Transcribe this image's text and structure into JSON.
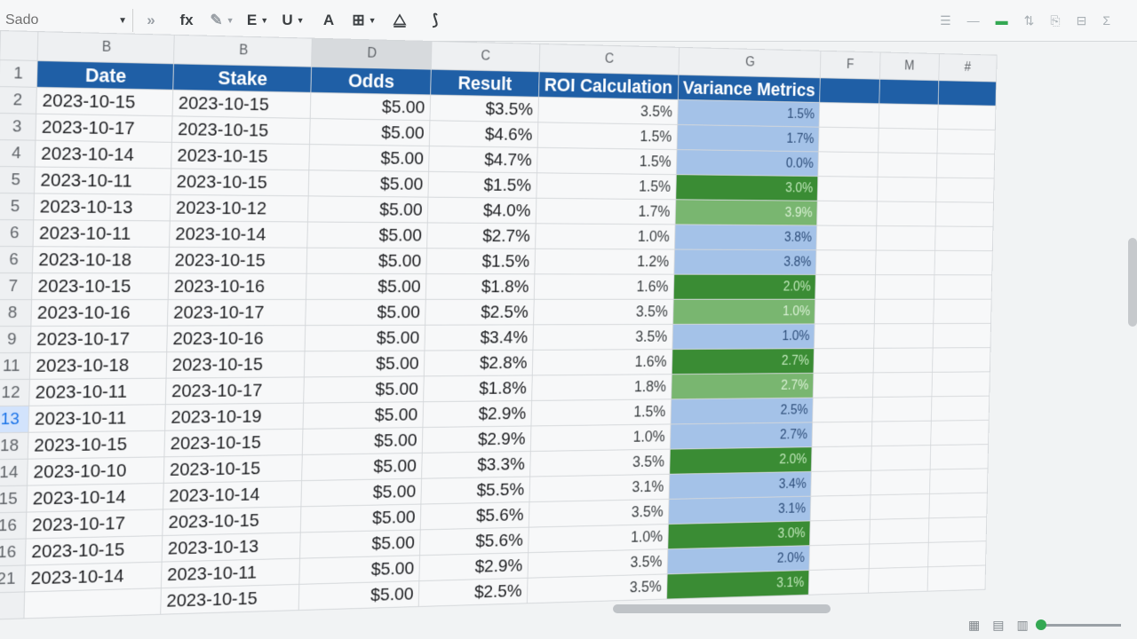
{
  "toolbar": {
    "name_box": "Sado",
    "buttons": [
      {
        "name": "collapse-icon",
        "glyph": "»",
        "faint": true
      },
      {
        "name": "function-icon",
        "glyph": "fx",
        "faint": false
      },
      {
        "name": "paint-format-icon",
        "glyph": "✎",
        "faint": true,
        "caret": true
      },
      {
        "name": "font-size-button",
        "glyph": "E",
        "faint": false,
        "caret": true
      },
      {
        "name": "underline-button",
        "glyph": "U",
        "faint": false,
        "caret": true
      },
      {
        "name": "text-color-icon",
        "glyph": "A",
        "faint": false
      },
      {
        "name": "borders-icon",
        "glyph": "⊞",
        "faint": false,
        "caret": true
      },
      {
        "name": "fill-color-icon",
        "glyph": "⧋",
        "faint": false
      },
      {
        "name": "clear-format-icon",
        "glyph": "⟆",
        "faint": false
      }
    ]
  },
  "columns": {
    "letters": [
      "B",
      "B",
      "D",
      "C",
      "C",
      "G",
      "F",
      "M",
      "#"
    ],
    "selected_index": 2
  },
  "header_row": {
    "row_number": "1",
    "labels": [
      "Date",
      "Stake",
      "Odds",
      "Result",
      "ROI Calculation",
      "Variance Metrics"
    ]
  },
  "active_row": "13",
  "rows": [
    {
      "n": "2",
      "date": "2023-10-15",
      "stake": "2023-10-15",
      "odds": "$5.00",
      "result": "$3.5%",
      "roi": "3.5%",
      "var": "1.5%",
      "tone": "blue"
    },
    {
      "n": "3",
      "date": "2023-10-17",
      "stake": "2023-10-15",
      "odds": "$5.00",
      "result": "$4.6%",
      "roi": "1.5%",
      "var": "1.7%",
      "tone": "blue"
    },
    {
      "n": "4",
      "date": "2023-10-14",
      "stake": "2023-10-15",
      "odds": "$5.00",
      "result": "$4.7%",
      "roi": "1.5%",
      "var": "0.0%",
      "tone": "blue"
    },
    {
      "n": "5",
      "date": "2023-10-11",
      "stake": "2023-10-15",
      "odds": "$5.00",
      "result": "$1.5%",
      "roi": "1.5%",
      "var": "3.0%",
      "tone": "green"
    },
    {
      "n": "5",
      "date": "2023-10-13",
      "stake": "2023-10-12",
      "odds": "$5.00",
      "result": "$4.0%",
      "roi": "1.7%",
      "var": "3.9%",
      "tone": "light"
    },
    {
      "n": "6",
      "date": "2023-10-11",
      "stake": "2023-10-14",
      "odds": "$5.00",
      "result": "$2.7%",
      "roi": "1.0%",
      "var": "3.8%",
      "tone": "blue"
    },
    {
      "n": "6",
      "date": "2023-10-18",
      "stake": "2023-10-15",
      "odds": "$5.00",
      "result": "$1.5%",
      "roi": "1.2%",
      "var": "3.8%",
      "tone": "blue"
    },
    {
      "n": "7",
      "date": "2023-10-15",
      "stake": "2023-10-16",
      "odds": "$5.00",
      "result": "$1.8%",
      "roi": "1.6%",
      "var": "2.0%",
      "tone": "green"
    },
    {
      "n": "8",
      "date": "2023-10-16",
      "stake": "2023-10-17",
      "odds": "$5.00",
      "result": "$2.5%",
      "roi": "3.5%",
      "var": "1.0%",
      "tone": "light"
    },
    {
      "n": "9",
      "date": "2023-10-17",
      "stake": "2023-10-16",
      "odds": "$5.00",
      "result": "$3.4%",
      "roi": "3.5%",
      "var": "1.0%",
      "tone": "blue"
    },
    {
      "n": "11",
      "date": "2023-10-18",
      "stake": "2023-10-15",
      "odds": "$5.00",
      "result": "$2.8%",
      "roi": "1.6%",
      "var": "2.7%",
      "tone": "green"
    },
    {
      "n": "12",
      "date": "2023-10-11",
      "stake": "2023-10-17",
      "odds": "$5.00",
      "result": "$1.8%",
      "roi": "1.8%",
      "var": "2.7%",
      "tone": "light"
    },
    {
      "n": "13",
      "date": "2023-10-11",
      "stake": "2023-10-19",
      "odds": "$5.00",
      "result": "$2.9%",
      "roi": "1.5%",
      "var": "2.5%",
      "tone": "blue"
    },
    {
      "n": "18",
      "date": "2023-10-15",
      "stake": "2023-10-15",
      "odds": "$5.00",
      "result": "$2.9%",
      "roi": "1.0%",
      "var": "2.7%",
      "tone": "blue"
    },
    {
      "n": "14",
      "date": "2023-10-10",
      "stake": "2023-10-15",
      "odds": "$5.00",
      "result": "$3.3%",
      "roi": "3.5%",
      "var": "2.0%",
      "tone": "green"
    },
    {
      "n": "15",
      "date": "2023-10-14",
      "stake": "2023-10-14",
      "odds": "$5.00",
      "result": "$5.5%",
      "roi": "3.1%",
      "var": "3.4%",
      "tone": "blue"
    },
    {
      "n": "16",
      "date": "2023-10-17",
      "stake": "2023-10-15",
      "odds": "$5.00",
      "result": "$5.6%",
      "roi": "3.5%",
      "var": "3.1%",
      "tone": "blue"
    },
    {
      "n": "16",
      "date": "2023-10-15",
      "stake": "2023-10-13",
      "odds": "$5.00",
      "result": "$5.6%",
      "roi": "1.0%",
      "var": "3.0%",
      "tone": "green"
    },
    {
      "n": "21",
      "date": "2023-10-14",
      "stake": "2023-10-11",
      "odds": "$5.00",
      "result": "$2.9%",
      "roi": "3.5%",
      "var": "2.0%",
      "tone": "blue"
    },
    {
      "n": "",
      "date": "",
      "stake": "2023-10-15",
      "odds": "$5.00",
      "result": "$2.5%",
      "roi": "3.5%",
      "var": "3.1%",
      "tone": "green"
    }
  ],
  "colors": {
    "header_fill": "#1f5fa6",
    "variance_blue": "#a4c2e8",
    "variance_green": "#3a8c34",
    "variance_light_green": "#79b670",
    "active_row_highlight": "#d2e3fc",
    "zoom_indicator": "#34a853"
  }
}
